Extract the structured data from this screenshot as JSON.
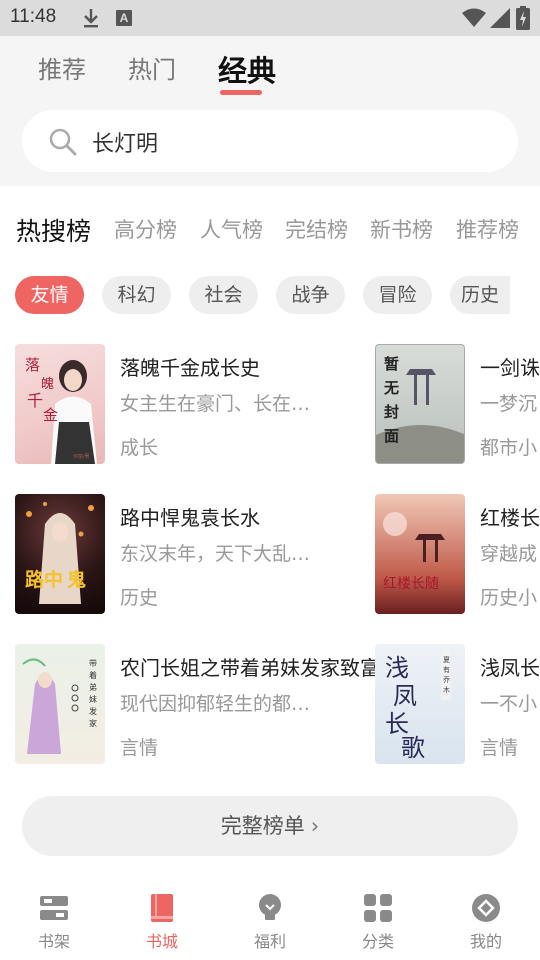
{
  "status_bar": {
    "time": "11:48",
    "a_icon_label": "A"
  },
  "tabs": [
    {
      "label": "推荐",
      "active": false
    },
    {
      "label": "热门",
      "active": false
    },
    {
      "label": "经典",
      "active": true
    }
  ],
  "search": {
    "value": "长灯明"
  },
  "rank_tabs": [
    {
      "label": "热搜榜",
      "active": true
    },
    {
      "label": "高分榜"
    },
    {
      "label": "人气榜"
    },
    {
      "label": "完结榜"
    },
    {
      "label": "新书榜"
    },
    {
      "label": "推荐榜"
    }
  ],
  "categories": [
    {
      "label": "友情",
      "active": true
    },
    {
      "label": "科幻"
    },
    {
      "label": "社会"
    },
    {
      "label": "战争"
    },
    {
      "label": "冒险"
    },
    {
      "label": "历史"
    }
  ],
  "books_left": [
    {
      "title": "落魄千金成长史",
      "desc": "女主生在豪门、长在…",
      "tag": "成长",
      "cover_text": "落魄千金成长史",
      "cover_author": "何苗/著"
    },
    {
      "title": "路中悍鬼袁长水",
      "desc": "东汉末年，天下大乱…",
      "tag": "历史",
      "cover_text": "路中悍鬼"
    },
    {
      "title": "农门长姐之带着弟妹发家致富",
      "desc": "现代因抑郁轻生的都…",
      "tag": "言情",
      "cover_text": "带着弟妹发家致富"
    }
  ],
  "books_right": [
    {
      "title": "一剑诛",
      "desc": "一梦沉",
      "tag": "都市小",
      "cover_text": "暂无封面"
    },
    {
      "title": "红楼长",
      "desc": "穿越成",
      "tag": "历史小",
      "cover_text": "红楼长随"
    },
    {
      "title": "浅凤长",
      "desc": "一不小",
      "tag": "言情",
      "cover_text": "浅凤长歌",
      "cover_author": "夏有乔木"
    }
  ],
  "full_list_button": {
    "label": "完整榜单",
    "chevron": "›"
  },
  "bottom_nav": [
    {
      "label": "书架",
      "icon": "bookshelf-icon",
      "active": false
    },
    {
      "label": "书城",
      "icon": "bookstore-icon",
      "active": true
    },
    {
      "label": "福利",
      "icon": "bulb-icon",
      "active": false
    },
    {
      "label": "分类",
      "icon": "grid-icon",
      "active": false
    },
    {
      "label": "我的",
      "icon": "profile-icon",
      "active": false
    }
  ],
  "colors": {
    "accent": "#ef6562",
    "chip_bg": "#eeeeef",
    "header_bg": "#f5f5f5"
  }
}
